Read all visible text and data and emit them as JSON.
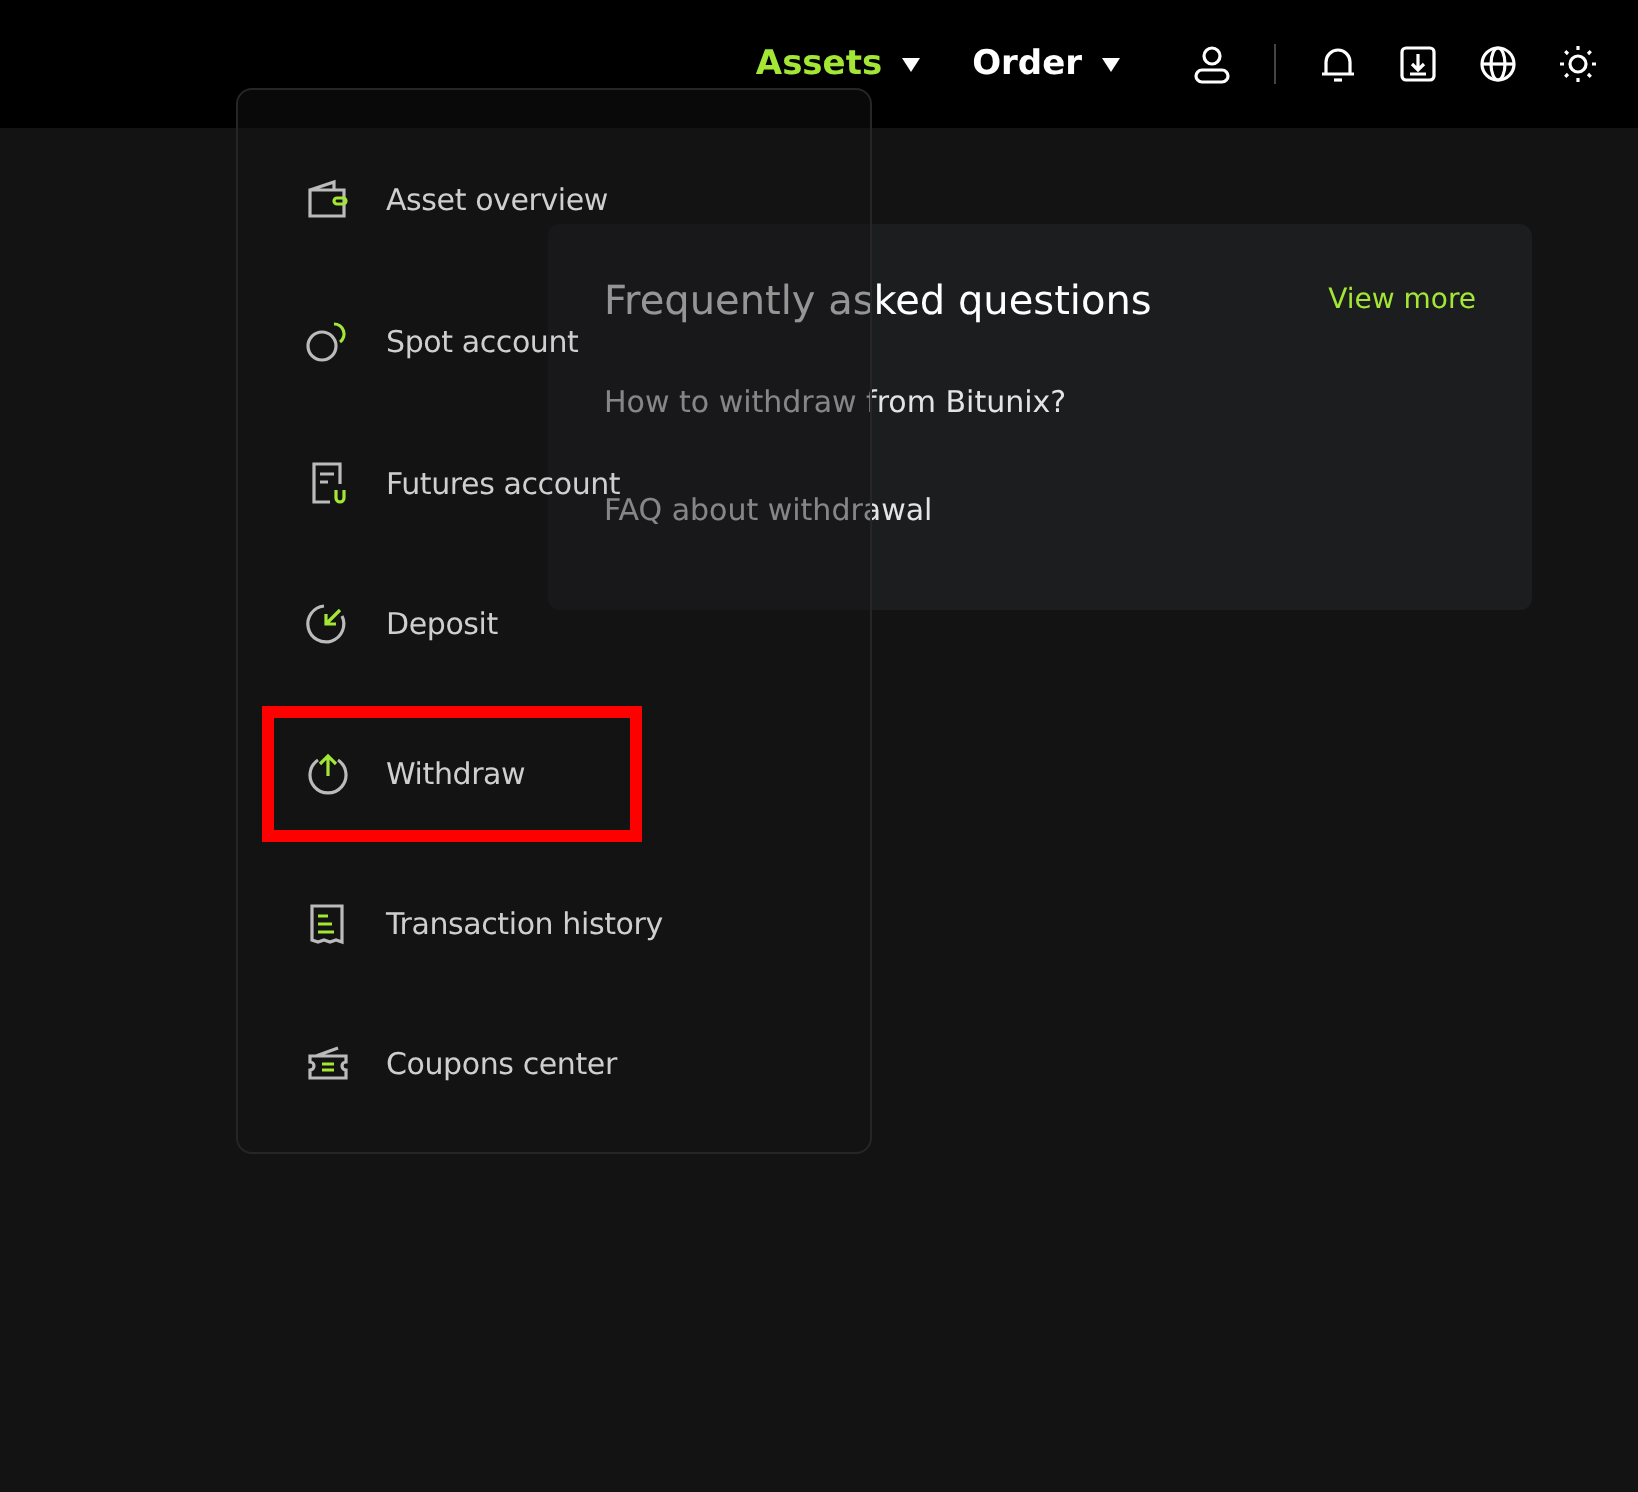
{
  "nav": [
    {
      "label": "Assets",
      "selected": true
    },
    {
      "label": "Order",
      "selected": false
    }
  ],
  "assets_menu": [
    {
      "label": "Asset overview",
      "highlighted": false
    },
    {
      "label": "Spot account",
      "highlighted": false
    },
    {
      "label": "Futures account",
      "highlighted": false
    },
    {
      "label": "Deposit",
      "highlighted": false
    },
    {
      "label": "Withdraw",
      "highlighted": true
    },
    {
      "label": "Transaction history",
      "highlighted": false
    },
    {
      "label": "Coupons center",
      "highlighted": false
    }
  ],
  "faq": {
    "title": "Frequently asked questions",
    "view_more": "View more",
    "questions": [
      "How to withdraw from Bitunix?",
      "FAQ about withdrawal"
    ]
  }
}
